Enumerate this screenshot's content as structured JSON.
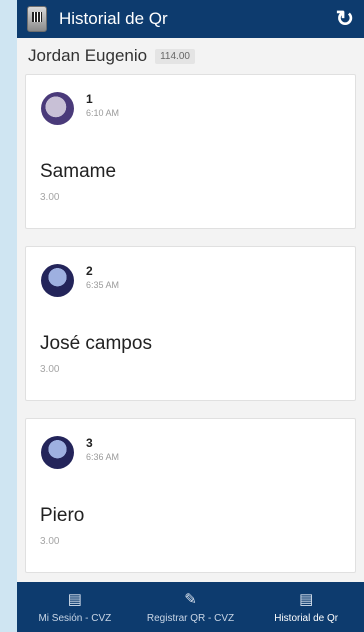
{
  "header": {
    "title": "Historial de Qr"
  },
  "user": {
    "name": "Jordan Eugenio",
    "total": "114.00"
  },
  "entries": [
    {
      "index": "1",
      "time": "6:10 AM",
      "name": "Samame",
      "amount": "3.00"
    },
    {
      "index": "2",
      "time": "6:35 AM",
      "name": "José campos",
      "amount": "3.00"
    },
    {
      "index": "3",
      "time": "6:36 AM",
      "name": "Piero",
      "amount": "3.00"
    }
  ],
  "tabs": [
    {
      "label": "Mi Sesión - CVZ",
      "icon": "id-card-icon"
    },
    {
      "label": "Registrar QR - CVZ",
      "icon": "pencil-icon"
    },
    {
      "label": "Historial de Qr",
      "icon": "list-icon"
    }
  ],
  "colors": {
    "bar": "#0d3b6e",
    "background": "#f3f3f3",
    "outer": "#cfe5f2"
  }
}
